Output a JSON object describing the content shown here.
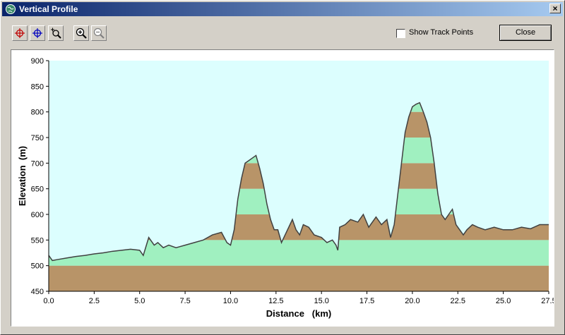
{
  "window": {
    "title": "Vertical Profile",
    "close_glyph": "×",
    "icon": "globe-icon"
  },
  "toolbar": {
    "buttons": [
      {
        "name": "select-point-tool",
        "icon": "crosshair-red-icon"
      },
      {
        "name": "pan-tool",
        "icon": "crosshair-blue-icon"
      },
      {
        "name": "zoom-box-tool",
        "icon": "zoom-box-icon"
      },
      {
        "name": "zoom-in-button",
        "icon": "zoom-in-icon"
      },
      {
        "name": "zoom-out-button",
        "icon": "zoom-out-icon"
      }
    ],
    "show_track_points_label": "Show Track Points",
    "show_track_points_checked": false,
    "close_label": "Close"
  },
  "chart_data": {
    "type": "area",
    "title": "",
    "xlabel": "Distance   (km)",
    "ylabel": "Elevation  (m)",
    "xlim": [
      0,
      27.5
    ],
    "ylim": [
      450,
      900
    ],
    "x_ticks": [
      "0.0",
      "2.5",
      "5.0",
      "7.5",
      "10.0",
      "12.5",
      "15.0",
      "17.5",
      "20.0",
      "22.5",
      "25.0",
      "27.5"
    ],
    "y_ticks": [
      "450",
      "500",
      "550",
      "600",
      "650",
      "700",
      "750",
      "800",
      "850",
      "900"
    ],
    "band_interval_m": 50,
    "colors": {
      "sky": "#dcfefe",
      "band_brown": "#b89468",
      "band_green": "#a0f0c0",
      "profile_line": "#404040"
    },
    "x": [
      0,
      0.2,
      0.5,
      1,
      1.5,
      2,
      2.5,
      3,
      3.5,
      4,
      4.5,
      5,
      5.2,
      5.5,
      5.8,
      6,
      6.3,
      6.6,
      7,
      7.5,
      8,
      8.5,
      9,
      9.5,
      9.8,
      10,
      10.2,
      10.4,
      10.6,
      10.8,
      11,
      11.2,
      11.4,
      11.6,
      11.8,
      12,
      12.2,
      12.4,
      12.6,
      12.8,
      13,
      13.2,
      13.4,
      13.6,
      13.8,
      14,
      14.3,
      14.6,
      15,
      15.3,
      15.6,
      15.8,
      15.9,
      16,
      16.3,
      16.6,
      17,
      17.3,
      17.6,
      18,
      18.3,
      18.6,
      18.8,
      19,
      19.2,
      19.4,
      19.6,
      19.8,
      20,
      20.2,
      20.4,
      20.6,
      20.8,
      21,
      21.2,
      21.4,
      21.6,
      21.8,
      22,
      22.2,
      22.4,
      22.6,
      22.8,
      23,
      23.3,
      23.6,
      24,
      24.5,
      25,
      25.5,
      26,
      26.5,
      27,
      27.5
    ],
    "y": [
      520,
      510,
      512,
      515,
      518,
      520,
      523,
      525,
      528,
      530,
      532,
      530,
      520,
      555,
      540,
      545,
      535,
      540,
      535,
      540,
      545,
      550,
      560,
      565,
      545,
      540,
      570,
      630,
      670,
      700,
      705,
      710,
      715,
      690,
      660,
      620,
      590,
      570,
      570,
      545,
      560,
      575,
      590,
      570,
      560,
      580,
      575,
      560,
      555,
      545,
      550,
      540,
      530,
      575,
      580,
      590,
      585,
      600,
      575,
      595,
      580,
      590,
      555,
      580,
      640,
      700,
      760,
      790,
      810,
      815,
      818,
      800,
      780,
      750,
      700,
      640,
      600,
      590,
      600,
      610,
      580,
      570,
      560,
      570,
      580,
      575,
      570,
      575,
      570,
      570,
      575,
      572,
      580,
      580
    ]
  }
}
